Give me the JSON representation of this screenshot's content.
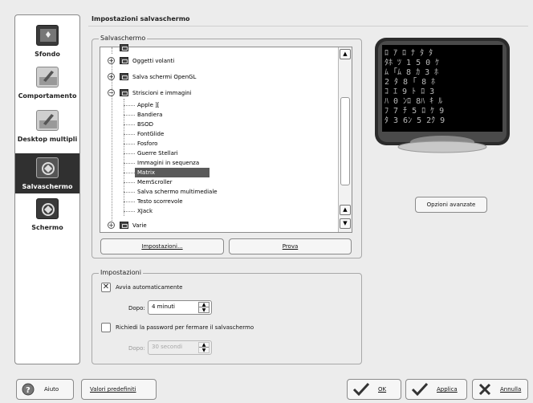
{
  "sidebar": {
    "items": [
      {
        "label": "Sfondo",
        "icon": "wallpaper-icon"
      },
      {
        "label": "Comportamento",
        "icon": "behavior-icon"
      },
      {
        "label": "Desktop multipli",
        "icon": "multiple-desktops-icon"
      },
      {
        "label": "Salvaschermo",
        "icon": "screensaver-icon",
        "active": true
      },
      {
        "label": "Schermo",
        "icon": "display-icon"
      }
    ]
  },
  "page_title": "Impostazioni salvaschermo",
  "screensaver_group": {
    "legend": "Salvaschermo",
    "tree": [
      {
        "label": "Oggetti volanti",
        "type": "category",
        "expanded": false
      },
      {
        "label": "Salva schermi OpenGL",
        "type": "category",
        "expanded": false
      },
      {
        "label": "Striscioni e immagini",
        "type": "category",
        "expanded": true
      },
      {
        "label": "Apple ][",
        "type": "item"
      },
      {
        "label": "Bandiera",
        "type": "item"
      },
      {
        "label": "BSOD",
        "type": "item"
      },
      {
        "label": "FontGlide",
        "type": "item"
      },
      {
        "label": "Fosforo",
        "type": "item"
      },
      {
        "label": "Guerre Stellari",
        "type": "item"
      },
      {
        "label": "Immagini in sequenza",
        "type": "item"
      },
      {
        "label": "Matrix",
        "type": "item",
        "selected": true
      },
      {
        "label": "MemScroller",
        "type": "item"
      },
      {
        "label": "Salva schermo multimediale",
        "type": "item"
      },
      {
        "label": "Testo scorrevole",
        "type": "item"
      },
      {
        "label": "XJack",
        "type": "item"
      },
      {
        "label": "Varie",
        "type": "category",
        "expanded": false
      }
    ],
    "settings_button": "Impostazioni...",
    "test_button": "Prova"
  },
  "advanced_button": "Opzioni avanzate",
  "settings_group": {
    "legend": "Impostazioni",
    "auto_start": {
      "label": "Avvia automaticamente",
      "checked": true
    },
    "after_label": "Dopo:",
    "after_value": "4 minuti",
    "require_password": {
      "label": "Richiedi la password per fermare il salvaschermo",
      "checked": false
    },
    "after2_label": "Dopo:",
    "after2_value": "30 secondi"
  },
  "bottom": {
    "help": "Aiuto",
    "defaults": "Valori predefiniti",
    "ok": "OK",
    "apply": "Applica",
    "cancel": "Annulla"
  },
  "colors": {
    "selection": "#5a5a5a",
    "sidebar_active": "#303030"
  }
}
